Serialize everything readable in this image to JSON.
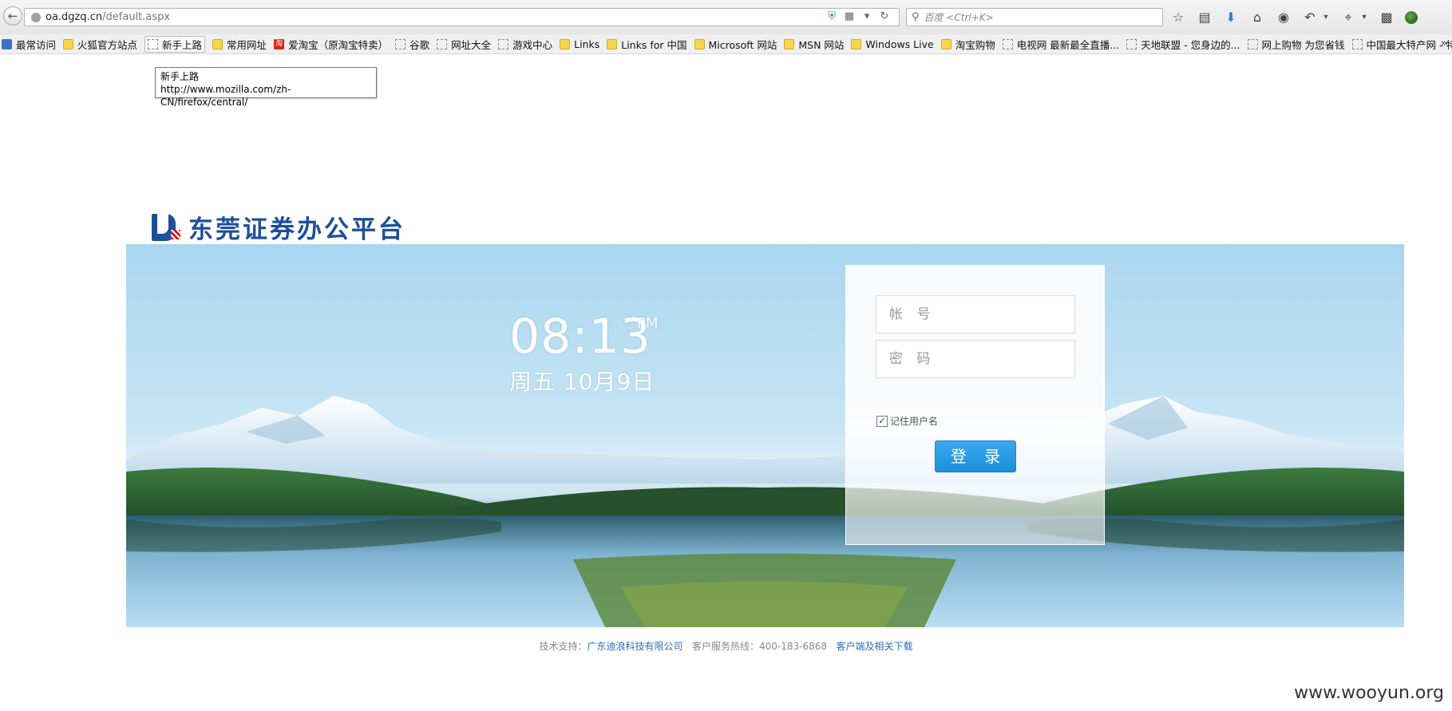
{
  "browser": {
    "url_host": "oa.dgzq.cn",
    "url_path": "/default.aspx",
    "search_placeholder": "百度 <Ctrl+K>",
    "toolbar_icons": [
      "star-icon",
      "reading-list-icon",
      "download-icon",
      "home-icon",
      "chat-icon",
      "undo-icon",
      "crop-icon",
      "speech-icon",
      "extension-icon"
    ]
  },
  "bookmarks": [
    {
      "label": "最常访问",
      "icon": "recent"
    },
    {
      "label": "火狐官方站点",
      "icon": "folder"
    },
    {
      "label": "新手上路",
      "icon": "page",
      "active": true
    },
    {
      "label": "常用网址",
      "icon": "folder"
    },
    {
      "label": "爱淘宝（原淘宝特卖）",
      "icon": "taobao"
    },
    {
      "label": "谷歌",
      "icon": "page"
    },
    {
      "label": "网址大全",
      "icon": "page"
    },
    {
      "label": "游戏中心",
      "icon": "page"
    },
    {
      "label": "Links",
      "icon": "folder"
    },
    {
      "label": "Links for 中国",
      "icon": "folder"
    },
    {
      "label": "Microsoft 网站",
      "icon": "folder"
    },
    {
      "label": "MSN 网站",
      "icon": "folder"
    },
    {
      "label": "Windows Live",
      "icon": "folder"
    },
    {
      "label": "淘宝购物",
      "icon": "folder"
    },
    {
      "label": "电视网 最新最全直播...",
      "icon": "page"
    },
    {
      "label": "天地联盟 - 您身边的...",
      "icon": "page"
    },
    {
      "label": "网上购物 为您省钱",
      "icon": "page"
    },
    {
      "label": "中国最大特产网 - 特...",
      "icon": "page"
    }
  ],
  "tooltip": {
    "title": "新手上路",
    "url": "http://www.mozilla.com/zh-CN/firefox/central/"
  },
  "brand": {
    "title": "东莞证券办公平台"
  },
  "clock": {
    "time": "08:13",
    "ampm": "PM",
    "date": "周五 10月9日"
  },
  "login": {
    "account_placeholder": "帐 号",
    "password_placeholder": "密 码",
    "remember_label": "记住用户名",
    "remember_checked": true,
    "submit_label": "登 录"
  },
  "footer": {
    "tech_prefix": "技术支持：",
    "tech_company": "广东迪浪科技有限公司",
    "hotline": "客户服务热线：400-183-6868",
    "download_link": "客户端及相关下载"
  },
  "watermark": "www.wooyun.org",
  "colors": {
    "brand_blue": "#1d4f9a",
    "button_blue": "#1b8fdc",
    "link_blue": "#2a6ebb"
  }
}
